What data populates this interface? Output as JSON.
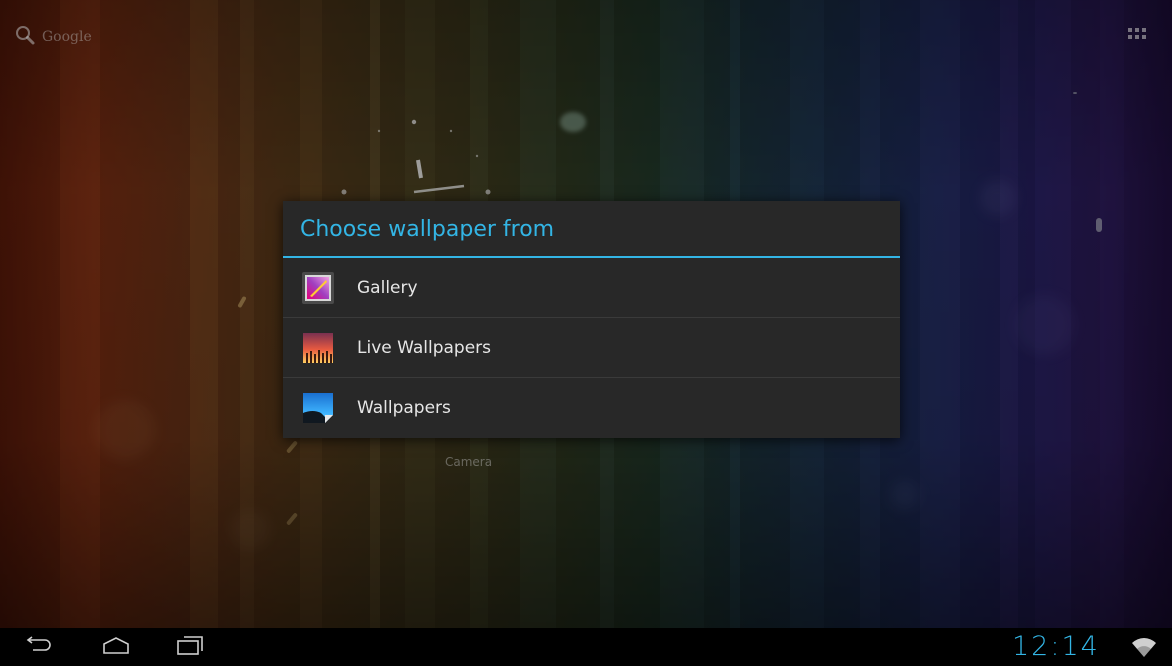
{
  "home": {
    "google_label": "Google",
    "camera_label": "Camera"
  },
  "dialog": {
    "title": "Choose wallpaper from",
    "options": [
      {
        "label": "Gallery",
        "icon": "gallery-icon"
      },
      {
        "label": "Live Wallpapers",
        "icon": "live-wallpapers-icon"
      },
      {
        "label": "Wallpapers",
        "icon": "wallpapers-icon"
      }
    ]
  },
  "status_bar": {
    "time": "12:14",
    "wifi_icon": "wifi-icon"
  },
  "nav_icons": [
    "back-icon",
    "home-icon",
    "recent-apps-icon"
  ],
  "colors": {
    "accent": "#33b5e5",
    "dialog_bg": "#282828"
  }
}
